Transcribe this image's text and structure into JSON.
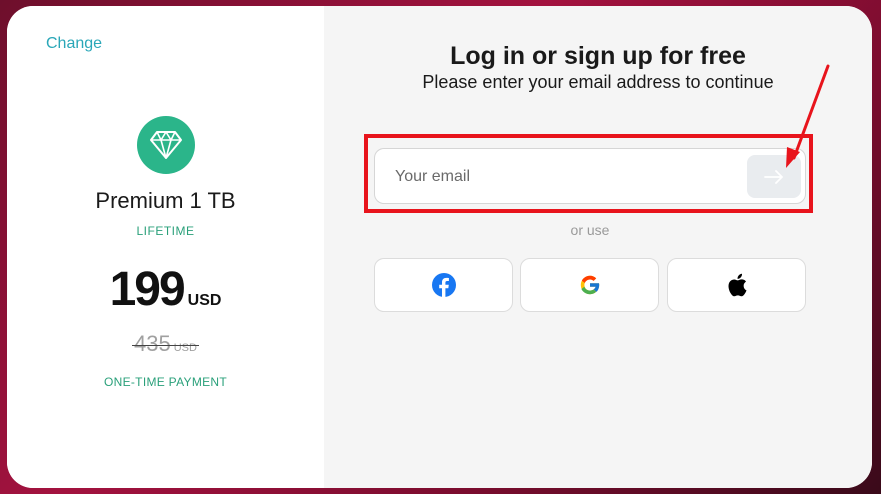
{
  "plan": {
    "change_label": "Change",
    "icon": "diamond-icon",
    "name": "Premium 1 TB",
    "term": "LIFETIME",
    "price": "199",
    "currency": "USD",
    "old_price": "435",
    "old_currency": "USD",
    "payment_type": "ONE-TIME PAYMENT"
  },
  "login": {
    "title": "Log in or sign up for free",
    "subtitle": "Please enter your email address to continue",
    "email_placeholder": "Your email",
    "email_value": "",
    "submit_icon": "arrow-right-icon",
    "or_use": "or use",
    "social": [
      {
        "provider": "facebook",
        "icon": "facebook-icon"
      },
      {
        "provider": "google",
        "icon": "google-icon"
      },
      {
        "provider": "apple",
        "icon": "apple-icon"
      }
    ]
  },
  "colors": {
    "accent_teal": "#2aa7b8",
    "accent_green": "#2bb58a",
    "highlight_red": "#e8141c",
    "facebook_blue": "#1877f2"
  }
}
